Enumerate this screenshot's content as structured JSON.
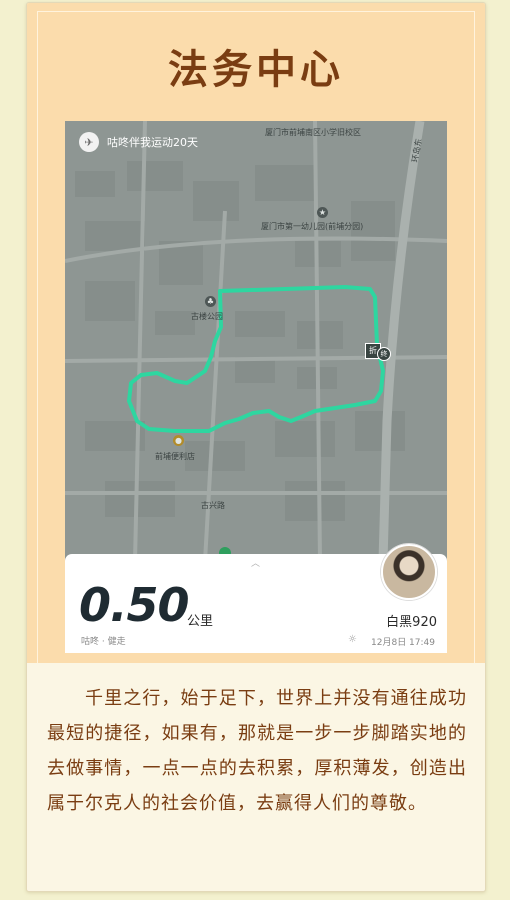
{
  "title": "法务中心",
  "screenshot": {
    "app_bar": {
      "logo_icon": "bird-icon",
      "text": "咕咚伴我运动20天"
    },
    "map": {
      "pois": [
        {
          "label": "厦门市前埔南区小学旧校区"
        },
        {
          "label": "厦门市第一幼儿园(前埔分园)"
        },
        {
          "label": "古楼公园"
        },
        {
          "label": "前埔便利店"
        },
        {
          "label": "古兴路"
        },
        {
          "label": "环岛东"
        }
      ],
      "end_marker": "折",
      "end_marker2": "终",
      "route_color": "#2ed6a0"
    },
    "stats": {
      "distance": "0.50",
      "unit": "公里",
      "activity": "咕咚 · 健走",
      "username": "白黑920",
      "weather_icon": "☼",
      "datetime": "12月8日 17:49"
    }
  },
  "paragraph": "千里之行，始于足下，世界上并没有通往成功最短的捷径，如果有，那就是一步一步脚踏实地的去做事情，一点一点的去积累，厚积薄发，创造出属于尔克人的社会价值，去赢得人们的尊敬。"
}
